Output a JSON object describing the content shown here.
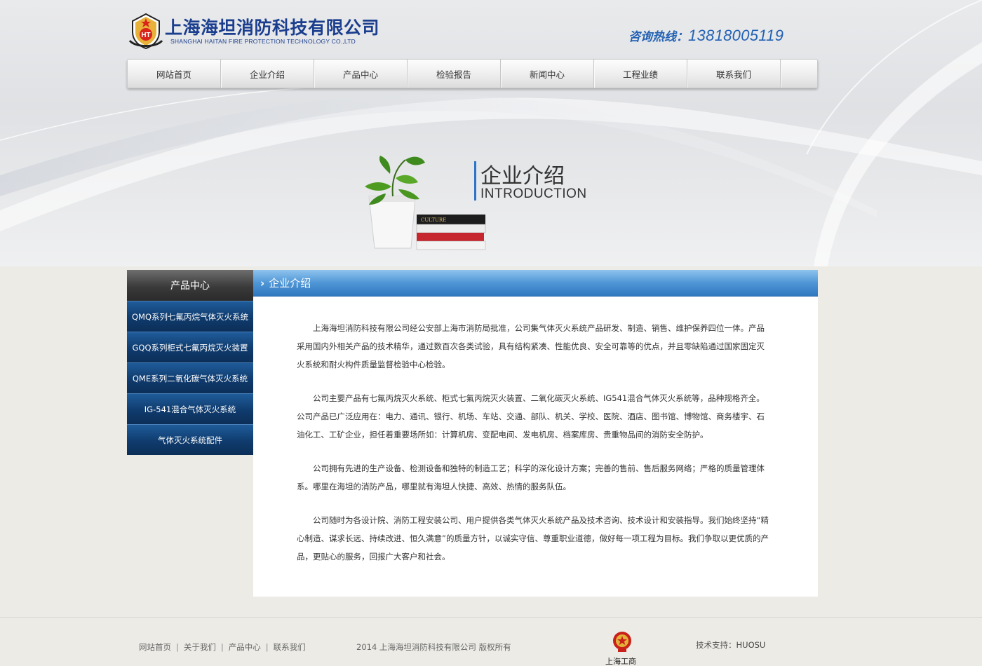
{
  "header": {
    "company_cn": "上海海坦消防科技有限公司",
    "company_en": "SHANGHAI HAITAN  FIRE PROTECTION TECHNOLOGY CO.,LTD",
    "logo_letters": "HT",
    "hotline_label": "咨询热线：",
    "hotline_number": "13818005119"
  },
  "nav": {
    "items": [
      "网站首页",
      "企业介绍",
      "产品中心",
      "检验报告",
      "新闻中心",
      "工程业绩",
      "联系我们"
    ]
  },
  "banner": {
    "title_cn": "企业介绍",
    "title_en": "INTRODUCTION",
    "book_text": "CULTURE"
  },
  "sidebar": {
    "heading": "产品中心",
    "items": [
      "QMQ系列七氟丙烷气体灭火系统",
      "GQQ系列柜式七氟丙烷灭火装置",
      "QME系列二氧化碳气体灭火系统",
      "IG-541混合气体灭火系统",
      "气体灭火系统配件"
    ]
  },
  "main": {
    "title": "企业介绍",
    "paragraphs": [
      "上海海坦消防科技有限公司经公安部上海市消防局批准，公司集气体灭火系统产品研发、制造、销售、维护保养四位一体。产品采用国内外相关产品的技术精华，通过数百次各类试验，具有结构紧凑、性能优良、安全可靠等的优点，并且零缺陷通过国家固定灭火系统和耐火构件质量监督检验中心检验。",
      "公司主要产品有七氟丙烷灭火系统、柜式七氟丙烷灭火装置、二氧化碳灭火系统、IG541混合气体灭火系统等，品种规格齐全。公司产品已广泛应用在：电力、通讯、银行、机场、车站、交通、部队、机关、学校、医院、酒店、图书馆、博物馆、商务楼宇、石油化工、工矿企业，担任着重要场所如：计算机房、变配电间、发电机房、档案库房、贵重物品间的消防安全防护。",
      "公司拥有先进的生产设备、检测设备和独特的制造工艺；科学的深化设计方案；完善的售前、售后服务网络；严格的质量管理体系。哪里在海坦的消防产品，哪里就有海坦人快捷、高效、热情的服务队伍。",
      "公司随时为各设计院、消防工程安装公司、用户提供各类气体灭火系统产品及技术咨询、技术设计和安装指导。我们始终坚持“精心制造、谋求长远、持续改进、恒久满意”的质量方针，以诚实守信、尊重职业道德，做好每一项工程为目标。我们争取以更优质的产品，更贴心的服务，回报广大客户和社会。"
    ]
  },
  "footer": {
    "links": [
      "网站首页",
      "关于我们",
      "产品中心",
      "联系我们"
    ],
    "separator": "|",
    "copyright": "2014  上海海坦消防科技有限公司  版权所有",
    "emblem_label": "上海工商",
    "support_label": "技术支持：",
    "support_value": "HUOSU"
  },
  "colors": {
    "brand_blue": "#1b3f8e",
    "hotline_blue": "#2361b3",
    "sidebar_blue": "#0f3b6d",
    "titlebar_blue": "#4f96d6"
  }
}
